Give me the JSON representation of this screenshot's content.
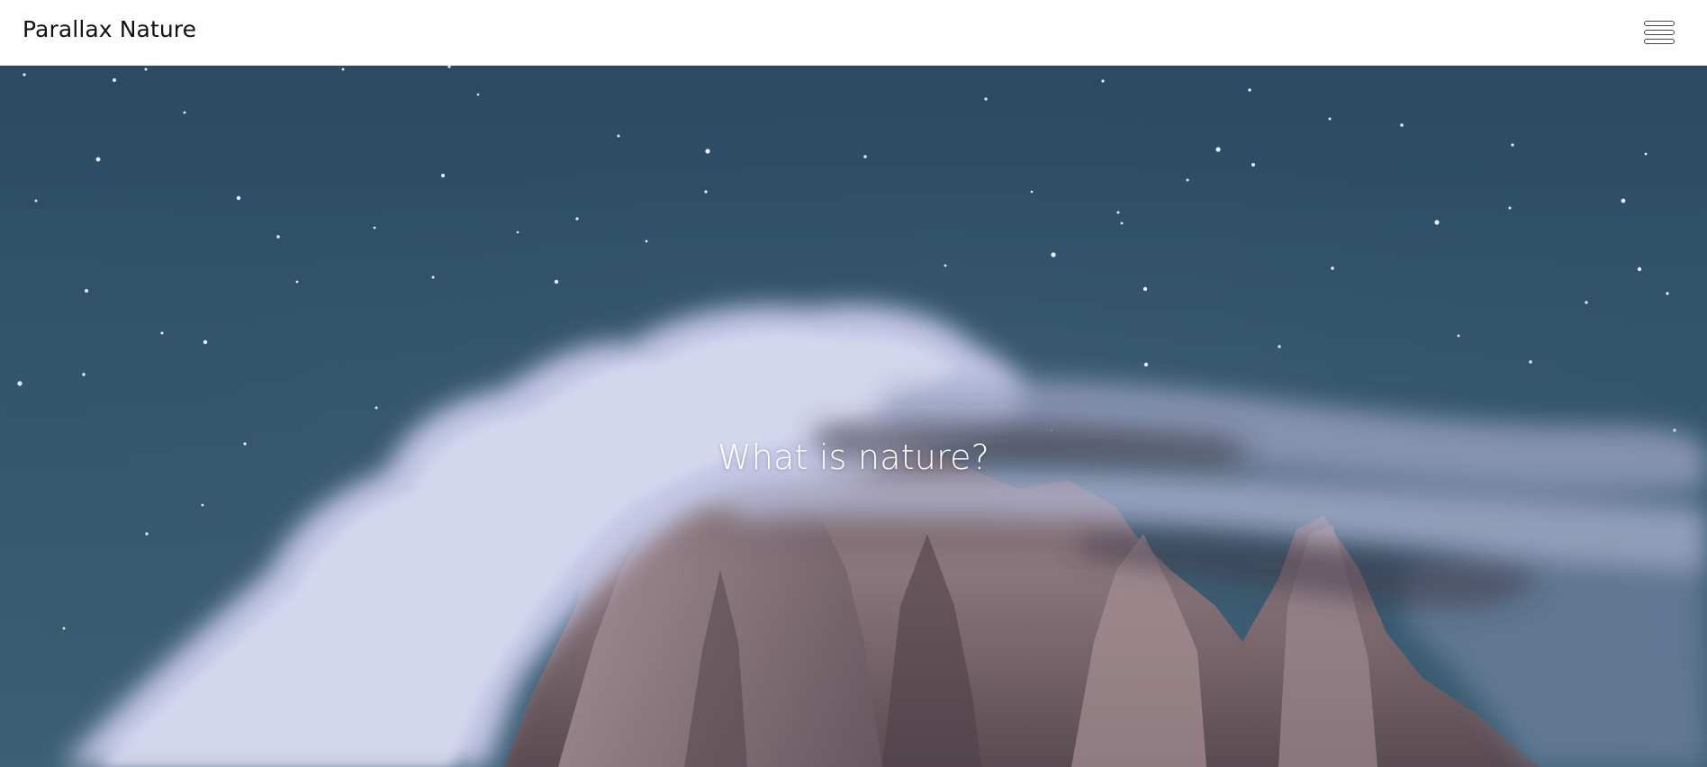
{
  "header": {
    "brand": "Parallax Nature",
    "menu_icon": "hamburger-menu-icon"
  },
  "hero": {
    "title": "What is nature?",
    "background_image": "night-sky-mountain-clouds",
    "colors": {
      "sky": "#2c4a61",
      "cloud": "#c9cde6",
      "rock": "#7a6b70"
    }
  }
}
